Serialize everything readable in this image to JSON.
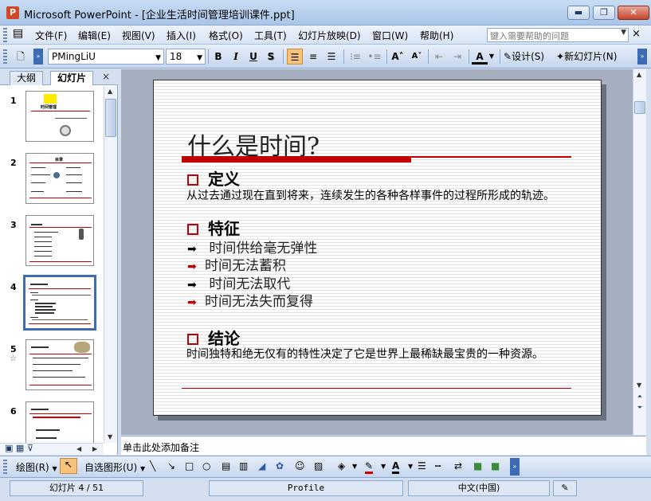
{
  "window": {
    "app_name": "Microsoft PowerPoint",
    "doc_title": " - [企业生活时间管理培训课件.ppt]",
    "min": "▬",
    "max": "❐",
    "close": "✕"
  },
  "menu": {
    "items": [
      "文件(F)",
      "编辑(E)",
      "视图(V)",
      "插入(I)",
      "格式(O)",
      "工具(T)",
      "幻灯片放映(D)",
      "窗口(W)",
      "帮助(H)"
    ],
    "help_placeholder": "键入需要帮助的问题",
    "close": "×"
  },
  "toolbar": {
    "font_name": "PMingLiU",
    "font_size": "18",
    "bold": "B",
    "italic": "I",
    "underline": "U",
    "shadow": "S",
    "design_label": "设计(S)",
    "new_slide_label": "新幻灯片(N)"
  },
  "left_panel": {
    "tabs": [
      "大纲",
      "幻灯片"
    ],
    "close": "×",
    "slides": [
      {
        "num": "1",
        "selected": false
      },
      {
        "num": "2",
        "selected": false
      },
      {
        "num": "3",
        "selected": false
      },
      {
        "num": "4",
        "selected": true
      },
      {
        "num": "5",
        "selected": false
      },
      {
        "num": "6",
        "selected": false
      }
    ],
    "thumb1_title": "时间管理",
    "thumb2_title": "目录"
  },
  "slide": {
    "title": "什么是时间?",
    "sections": [
      {
        "heading": "定义",
        "body": "从过去通过现在直到将来，连续发生的各种各样事件的过程所形成的轨迹。"
      },
      {
        "heading": "特征",
        "bullets": [
          {
            "text": " 时间供给毫无弹性",
            "color": "#000000"
          },
          {
            "text": "时间无法蓄积",
            "color": "#c00000"
          },
          {
            "text": " 时间无法取代",
            "color": "#000000"
          },
          {
            "text": "时间无法失而复得",
            "color": "#c00000"
          }
        ]
      },
      {
        "heading": "结论",
        "body": "时间独特和绝无仅有的特性决定了它是世界上最稀缺最宝贵的一种资源。"
      }
    ]
  },
  "notes": {
    "placeholder": "单击此处添加备注"
  },
  "drawbar": {
    "draw_label": "绘图(R)",
    "autoshape_label": "自选图形(U)"
  },
  "status": {
    "slide_pos": "幻灯片 4 / 51",
    "design": "Profile",
    "language": "中文(中国)"
  },
  "colors": {
    "accent_red": "#c00000",
    "selection_blue": "#3d6cb5"
  }
}
